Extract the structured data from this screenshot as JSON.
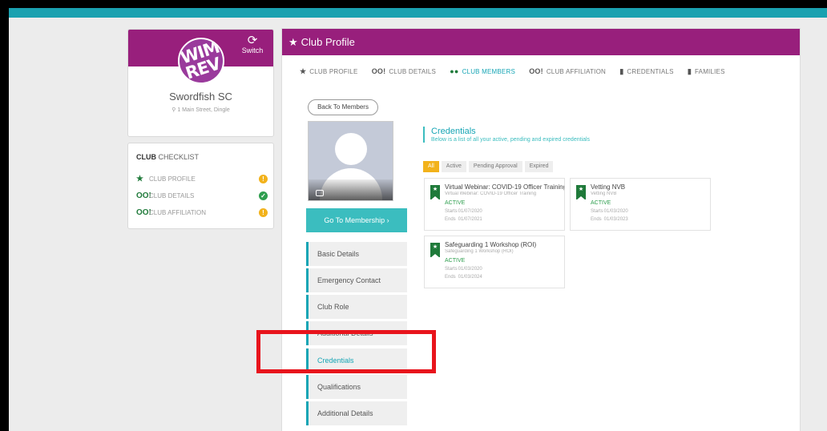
{
  "colors": {
    "brand": "#981f7c",
    "accent": "#16a5b5",
    "teal_bar": "#1aa1b0",
    "highlight": "#e8141c",
    "active_green": "#2e9e4e"
  },
  "club": {
    "logo_text": "WIM REV",
    "switch_label": "Switch",
    "switch_icon": "refresh-icon",
    "name": "Swordfish SC",
    "address": "1 Main Street, Dingle"
  },
  "checklist": {
    "title_bold": "CLUB",
    "title_rest": "CHECKLIST",
    "items": [
      {
        "icon": "★",
        "label": "CLUB PROFILE",
        "status": "warning"
      },
      {
        "icon": "OO!",
        "label": "CLUB DETAILS",
        "status": "ok"
      },
      {
        "icon": "OO!",
        "label": "CLUB AFFILIATION",
        "status": "warning"
      }
    ]
  },
  "header": {
    "title": "Club Profile"
  },
  "tabs": [
    {
      "icon": "★",
      "label": "CLUB PROFILE"
    },
    {
      "icon": "OO!",
      "label": "CLUB DETAILS"
    },
    {
      "icon": "●●",
      "label": "CLUB MEMBERS",
      "active": true
    },
    {
      "icon": "OO!",
      "label": "CLUB AFFILIATION"
    },
    {
      "icon": "▮",
      "label": "CREDENTIALS"
    },
    {
      "icon": "▮",
      "label": "FAMILIES"
    }
  ],
  "member": {
    "back_label": "Back To Members",
    "goto_label": "Go To Membership ›"
  },
  "nav": [
    {
      "label": "Basic Details"
    },
    {
      "label": "Emergency Contact"
    },
    {
      "label": "Club Role"
    },
    {
      "label": "Additional Details"
    },
    {
      "label": "Credentials",
      "active": true
    },
    {
      "label": "Qualifications"
    },
    {
      "label": "Additional Details"
    }
  ],
  "credentials": {
    "title": "Credentials",
    "subtitle": "Below is a list of all your active, pending and expired credentials",
    "filters": [
      {
        "label": "All",
        "active": true
      },
      {
        "label": "Active"
      },
      {
        "label": "Pending Approval"
      },
      {
        "label": "Expired"
      }
    ],
    "start_label": "Starts",
    "end_label": "Ends",
    "cards": [
      {
        "name": "Virtual Webinar: COVID-19 Officer Training",
        "sub": "Virtual Webinar: COVID-19 Officer Training",
        "status": "ACTIVE",
        "start": "01/07/2020",
        "end": "01/07/2021"
      },
      {
        "name": "Vetting NVB",
        "sub": "Vetting NVB",
        "status": "ACTIVE",
        "start": "01/03/2020",
        "end": "01/03/2023"
      },
      {
        "name": "Safeguarding 1 Workshop (ROI)",
        "sub": "Safeguarding 1 Workshop (ROI)",
        "status": "ACTIVE",
        "start": "01/03/2020",
        "end": "01/03/2024"
      }
    ]
  }
}
